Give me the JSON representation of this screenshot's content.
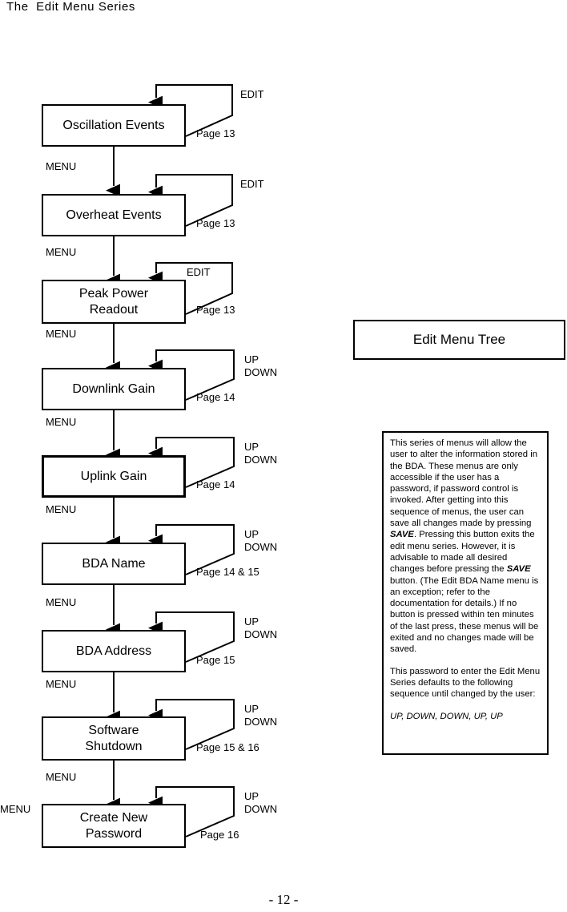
{
  "document": {
    "title": "The  Edit Menu Series",
    "footer": "- 12 -"
  },
  "tree_title": {
    "label": "Edit Menu Tree"
  },
  "standalone_menu_label": "MENU",
  "nodes": [
    {
      "label": "Oscillation Events",
      "loop_label": "EDIT",
      "page_ref": "Page 13",
      "menu_label": "MENU"
    },
    {
      "label": "Overheat Events",
      "loop_label": "EDIT",
      "page_ref": "Page 13",
      "menu_label": "MENU"
    },
    {
      "label": "Peak Power\nReadout",
      "loop_label": "EDIT",
      "page_ref": "Page 13",
      "menu_label": "MENU"
    },
    {
      "label": "Downlink Gain",
      "loop_label": "UP\nDOWN",
      "page_ref": "Page 14",
      "menu_label": "MENU"
    },
    {
      "label": "Uplink Gain",
      "loop_label": "UP\nDOWN",
      "page_ref": "Page 14",
      "menu_label": "MENU"
    },
    {
      "label": "BDA Name",
      "loop_label": "UP\nDOWN",
      "page_ref": "Page 14 & 15",
      "menu_label": "MENU"
    },
    {
      "label": "BDA Address",
      "loop_label": "UP\nDOWN",
      "page_ref": "Page 15",
      "menu_label": "MENU"
    },
    {
      "label": "Software\nShutdown",
      "loop_label": "UP\nDOWN",
      "page_ref": "Page 15 & 16",
      "menu_label": "MENU"
    },
    {
      "label": "Create New\nPassword",
      "loop_label": "UP\nDOWN",
      "page_ref": "Page 16",
      "menu_label": ""
    }
  ],
  "note": {
    "paragraph_1_a": "This series of menus will allow the user to alter the information stored in the BDA. These menus are only accessible if the user has a password, if password control is invoked. After getting into this sequence of menus, the user can save all changes made by pressing ",
    "save_word_1": "SAVE",
    "paragraph_1_b": ". Pressing this button exits the edit menu series. However, it is advisable to made all desired changes before pressing the ",
    "save_word_2": "SAVE",
    "paragraph_1_c": " button. (The Edit BDA Name menu is an exception; refer to the documentation for details.)  If no button is pressed within ten minutes of the last press, these menus will be exited and no changes made will be saved.",
    "paragraph_2": "This password to enter the Edit Menu Series defaults to the following sequence until changed by the user:",
    "password_sequence": "UP, DOWN, DOWN, UP, UP"
  },
  "colors": {
    "stroke": "#000000",
    "background": "#ffffff"
  }
}
